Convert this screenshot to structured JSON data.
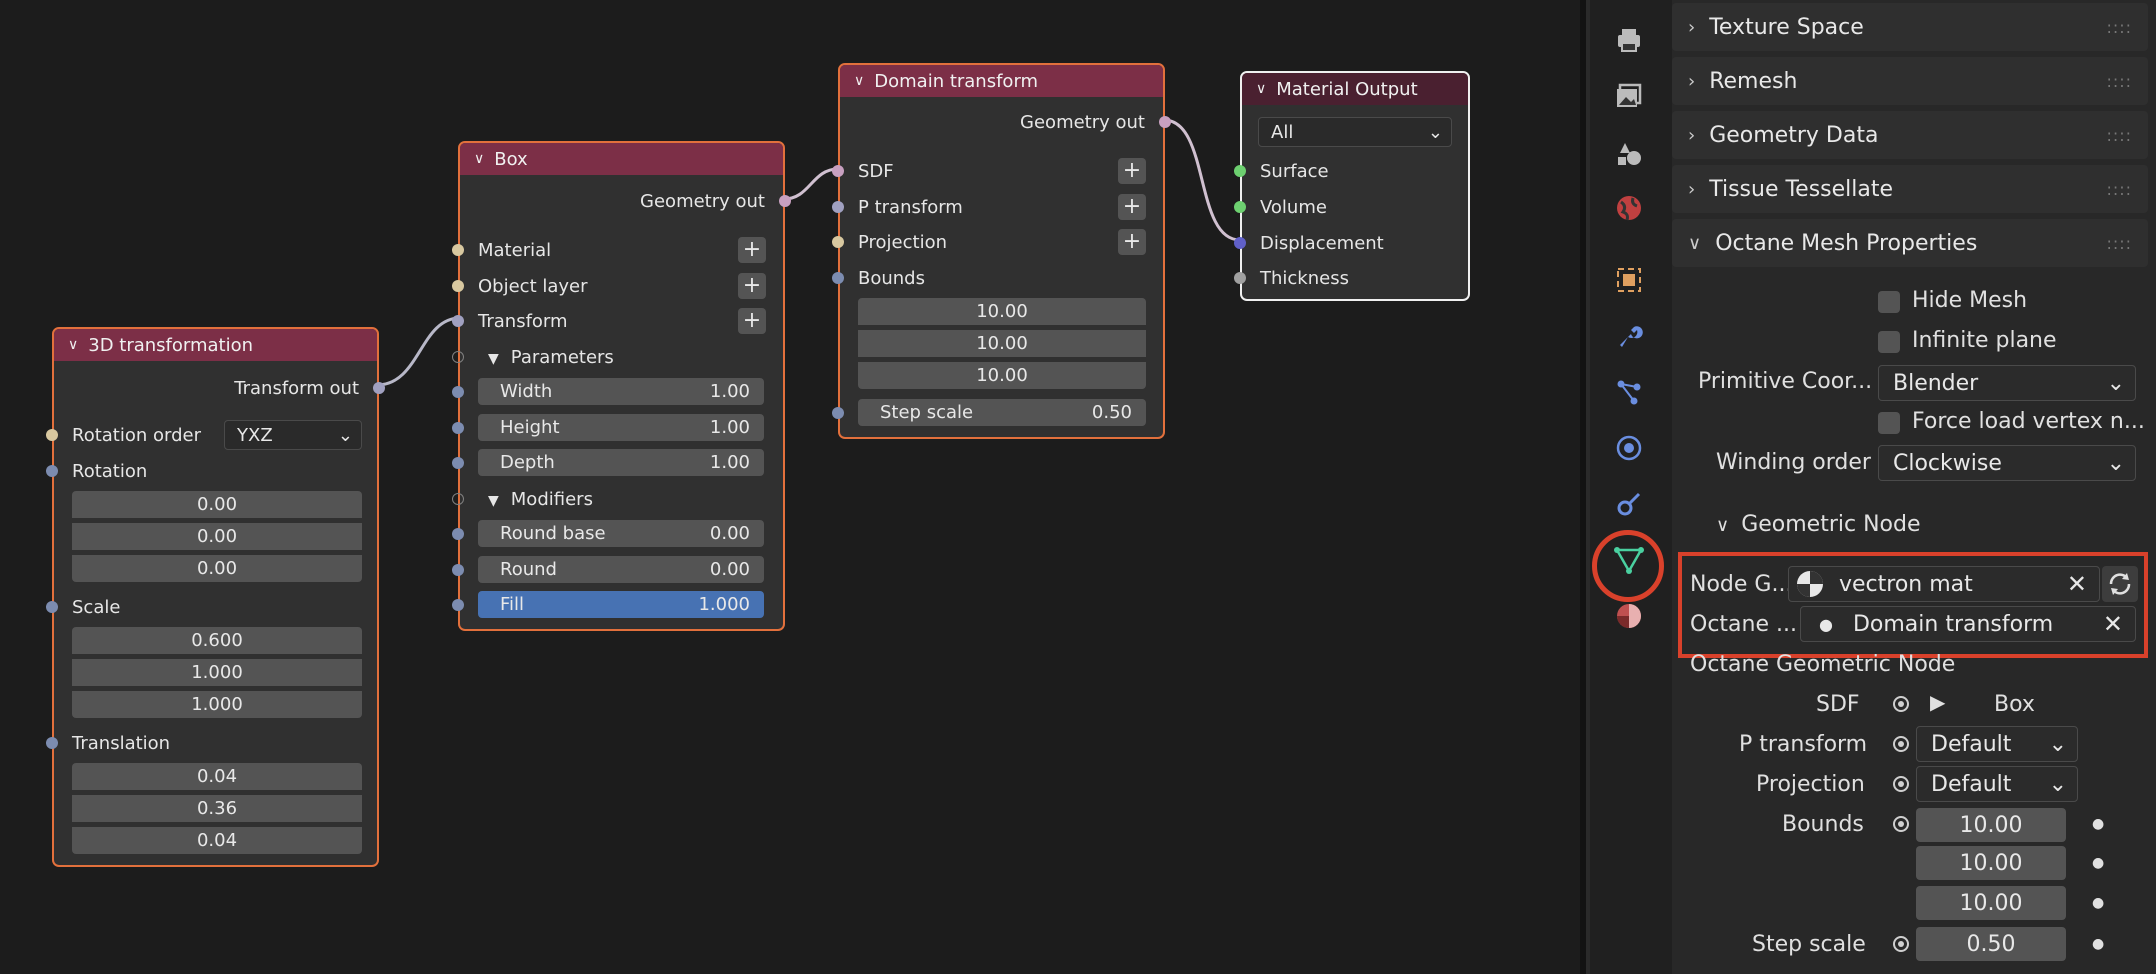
{
  "nodes": {
    "transform3d": {
      "title": "3D transformation",
      "output": "Transform out",
      "rotation_order_label": "Rotation order",
      "rotation_order_value": "YXZ",
      "rotation_label": "Rotation",
      "rotation": [
        "0.00",
        "0.00",
        "0.00"
      ],
      "scale_label": "Scale",
      "scale": [
        "0.600",
        "1.000",
        "1.000"
      ],
      "translation_label": "Translation",
      "translation": [
        "0.04",
        "0.36",
        "0.04"
      ]
    },
    "box": {
      "title": "Box",
      "output": "Geometry out",
      "material": "Material",
      "object_layer": "Object layer",
      "transform": "Transform",
      "parameters": "Parameters",
      "width_label": "Width",
      "width": "1.00",
      "height_label": "Height",
      "height": "1.00",
      "depth_label": "Depth",
      "depth": "1.00",
      "modifiers": "Modifiers",
      "round_base_label": "Round base",
      "round_base": "0.00",
      "round_label": "Round",
      "round": "0.00",
      "fill_label": "Fill",
      "fill": "1.000"
    },
    "domain": {
      "title": "Domain transform",
      "output": "Geometry out",
      "sdf": "SDF",
      "p_transform": "P transform",
      "projection": "Projection",
      "bounds": "Bounds",
      "bounds_values": [
        "10.00",
        "10.00",
        "10.00"
      ],
      "step_scale_label": "Step scale",
      "step_scale": "0.50"
    },
    "material_output": {
      "title": "Material Output",
      "target": "All",
      "surface": "Surface",
      "volume": "Volume",
      "displacement": "Displacement",
      "thickness": "Thickness"
    }
  },
  "properties": {
    "panels": [
      "Texture Space",
      "Remesh",
      "Geometry Data",
      "Tissue Tessellate",
      "Octane Mesh Properties"
    ],
    "hide_mesh": "Hide Mesh",
    "infinite_plane": "Infinite plane",
    "primitive_coord_label": "Primitive Coor...",
    "primitive_coord_value": "Blender",
    "force_load": "Force load vertex n...",
    "winding_label": "Winding order",
    "winding_value": "Clockwise",
    "geometric_node": "Geometric Node",
    "node_group_label": "Node G...",
    "node_group_value": "vectron mat",
    "octane_label": "Octane ...",
    "octane_value": "Domain transform",
    "octane_geo_node": "Octane Geometric Node",
    "sdf_label": "SDF",
    "sdf_value": "Box",
    "p_transform_label": "P transform",
    "p_transform_value": "Default",
    "projection_label": "Projection",
    "projection_value": "Default",
    "bounds_label": "Bounds",
    "bounds": [
      "10.00",
      "10.00",
      "10.00"
    ],
    "step_scale_label": "Step scale",
    "step_scale": "0.50",
    "grip": "::::"
  },
  "colors": {
    "accent_highlight": "#d9412b",
    "node_border": "#e2703c",
    "node_header": "#7c2f47",
    "fill_blue": "#4772b3"
  }
}
